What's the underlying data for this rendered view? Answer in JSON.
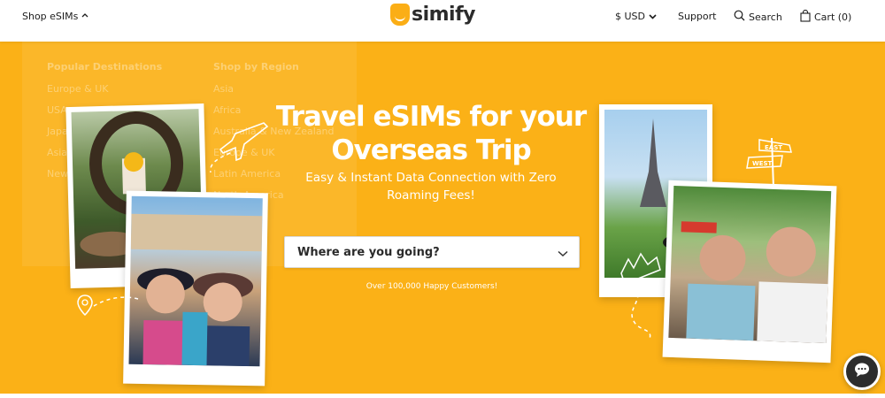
{
  "header": {
    "shop_label": "Shop eSIMs",
    "logo_text": "simify",
    "currency_label": "$ USD",
    "support_label": "Support",
    "search_label": "Search",
    "cart_label": "Cart (0)"
  },
  "mega_menu": {
    "popular_heading": "Popular Destinations",
    "popular_items": [
      "Europe & UK",
      "USA",
      "Japan",
      "Asia",
      "New Zealand"
    ],
    "region_heading": "Shop by Region",
    "region_items": [
      "Asia",
      "Africa",
      "Australia & New Zealand",
      "Europe & UK",
      "Latin America",
      "North America"
    ]
  },
  "hero": {
    "title": "Travel eSIMs for your Overseas Trip",
    "subtitle": "Easy & Instant Data Connection with Zero Roaming Fees!",
    "destination_placeholder": "Where are you going?",
    "happy_customers": "Over 100,000 Happy Customers!"
  },
  "doodles": {
    "sign_top": "EAST",
    "sign_bottom": "WEST"
  },
  "colors": {
    "hero_bg": "#fbb117",
    "accent": "#fbae16",
    "text_dark": "#1c1c1c"
  },
  "icons": [
    "chevron-up-icon",
    "chevron-down-icon",
    "search-icon",
    "bag-icon",
    "chat-icon",
    "airplane-icon",
    "map-pin-icon",
    "signpost-icon"
  ]
}
